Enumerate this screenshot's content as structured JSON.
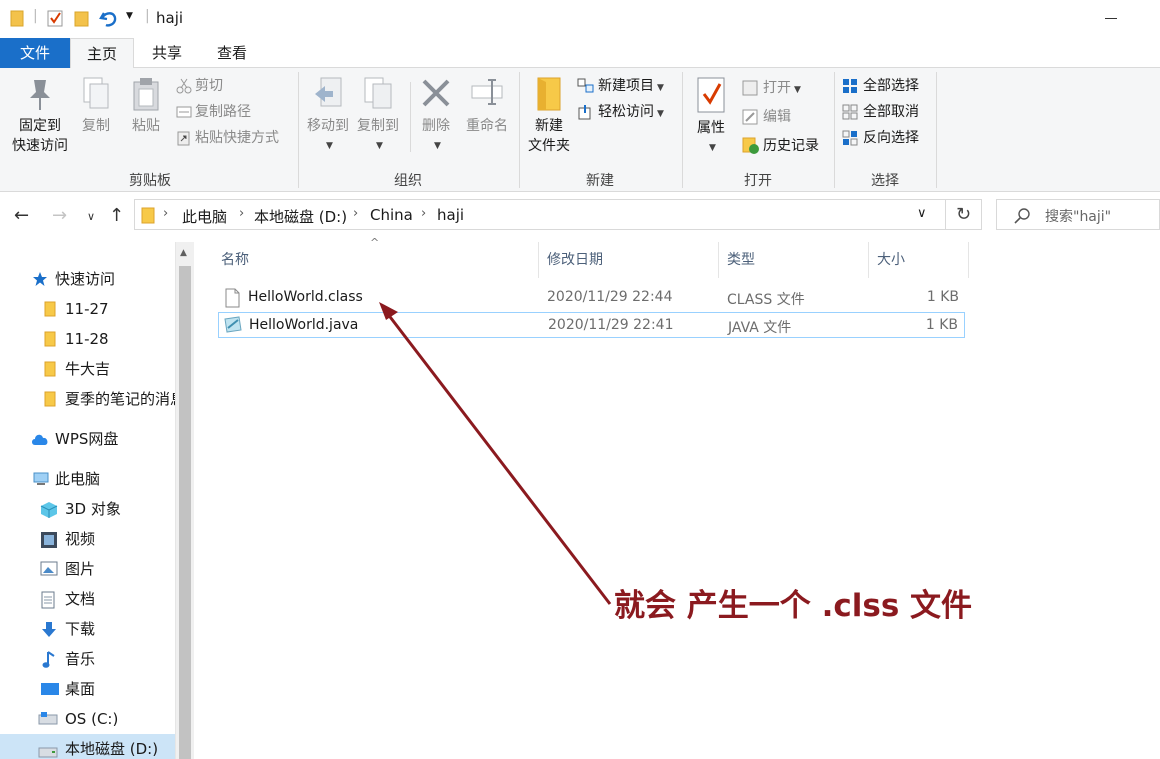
{
  "window": {
    "title": "haji"
  },
  "tabs": [
    {
      "label": "文件"
    },
    {
      "label": "主页"
    },
    {
      "label": "共享"
    },
    {
      "label": "查看"
    }
  ],
  "ribbon": {
    "clipboard": {
      "group_label": "剪贴板",
      "pin_label_1": "固定到",
      "pin_label_2": "快速访问",
      "copy_label": "复制",
      "paste_label": "粘贴",
      "cut_label": "剪切",
      "copy_path_label": "复制路径",
      "paste_shortcut_label": "粘贴快捷方式"
    },
    "organize": {
      "group_label": "组织",
      "move_to_label": "移动到",
      "copy_to_label": "复制到",
      "delete_label": "删除",
      "rename_label": "重命名"
    },
    "new": {
      "group_label": "新建",
      "new_folder_label_1": "新建",
      "new_folder_label_2": "文件夹",
      "new_item_label": "新建项目",
      "easy_access_label": "轻松访问"
    },
    "open": {
      "group_label": "打开",
      "properties_label": "属性",
      "open_label": "打开",
      "edit_label": "编辑",
      "history_label": "历史记录"
    },
    "select": {
      "group_label": "选择",
      "select_all_label": "全部选择",
      "select_none_label": "全部取消",
      "invert_label": "反向选择"
    }
  },
  "address": {
    "breadcrumbs": [
      "此电脑",
      "本地磁盘 (D:)",
      "China",
      "haji"
    ],
    "search_placeholder": "搜索\"haji\""
  },
  "nav_pane": {
    "items": [
      {
        "label": "快速访问",
        "icon": "star-icon"
      },
      {
        "label": "11-27",
        "icon": "folder-icon"
      },
      {
        "label": "11-28",
        "icon": "folder-icon"
      },
      {
        "label": "牛大吉",
        "icon": "folder-icon"
      },
      {
        "label": "夏季的笔记的消息",
        "icon": "folder-icon"
      },
      {
        "label": "WPS网盘",
        "icon": "cloud-icon"
      },
      {
        "label": "此电脑",
        "icon": "computer-icon"
      },
      {
        "label": "3D 对象",
        "icon": "cube-icon"
      },
      {
        "label": "视频",
        "icon": "film-icon"
      },
      {
        "label": "图片",
        "icon": "picture-icon"
      },
      {
        "label": "文档",
        "icon": "document-icon"
      },
      {
        "label": "下载",
        "icon": "download-icon"
      },
      {
        "label": "音乐",
        "icon": "music-icon"
      },
      {
        "label": "桌面",
        "icon": "desktop-icon"
      },
      {
        "label": "OS (C:)",
        "icon": "drive-icon"
      },
      {
        "label": "本地磁盘 (D:)",
        "icon": "drive-icon"
      }
    ]
  },
  "file_list": {
    "columns": [
      "名称",
      "修改日期",
      "类型",
      "大小"
    ],
    "rows": [
      {
        "name": "HelloWorld.class",
        "date": "2020/11/29 22:44",
        "type": "CLASS 文件",
        "size": "1 KB"
      },
      {
        "name": "HelloWorld.java",
        "date": "2020/11/29 22:41",
        "type": "JAVA 文件",
        "size": "1 KB"
      }
    ]
  },
  "annotation": {
    "text": "就会 产生一个 .clss 文件",
    "color": "#8b1a1f"
  },
  "colors": {
    "accent": "#1a6fc9",
    "selection": "#cce4f7",
    "annotation": "#8b1a1f"
  }
}
